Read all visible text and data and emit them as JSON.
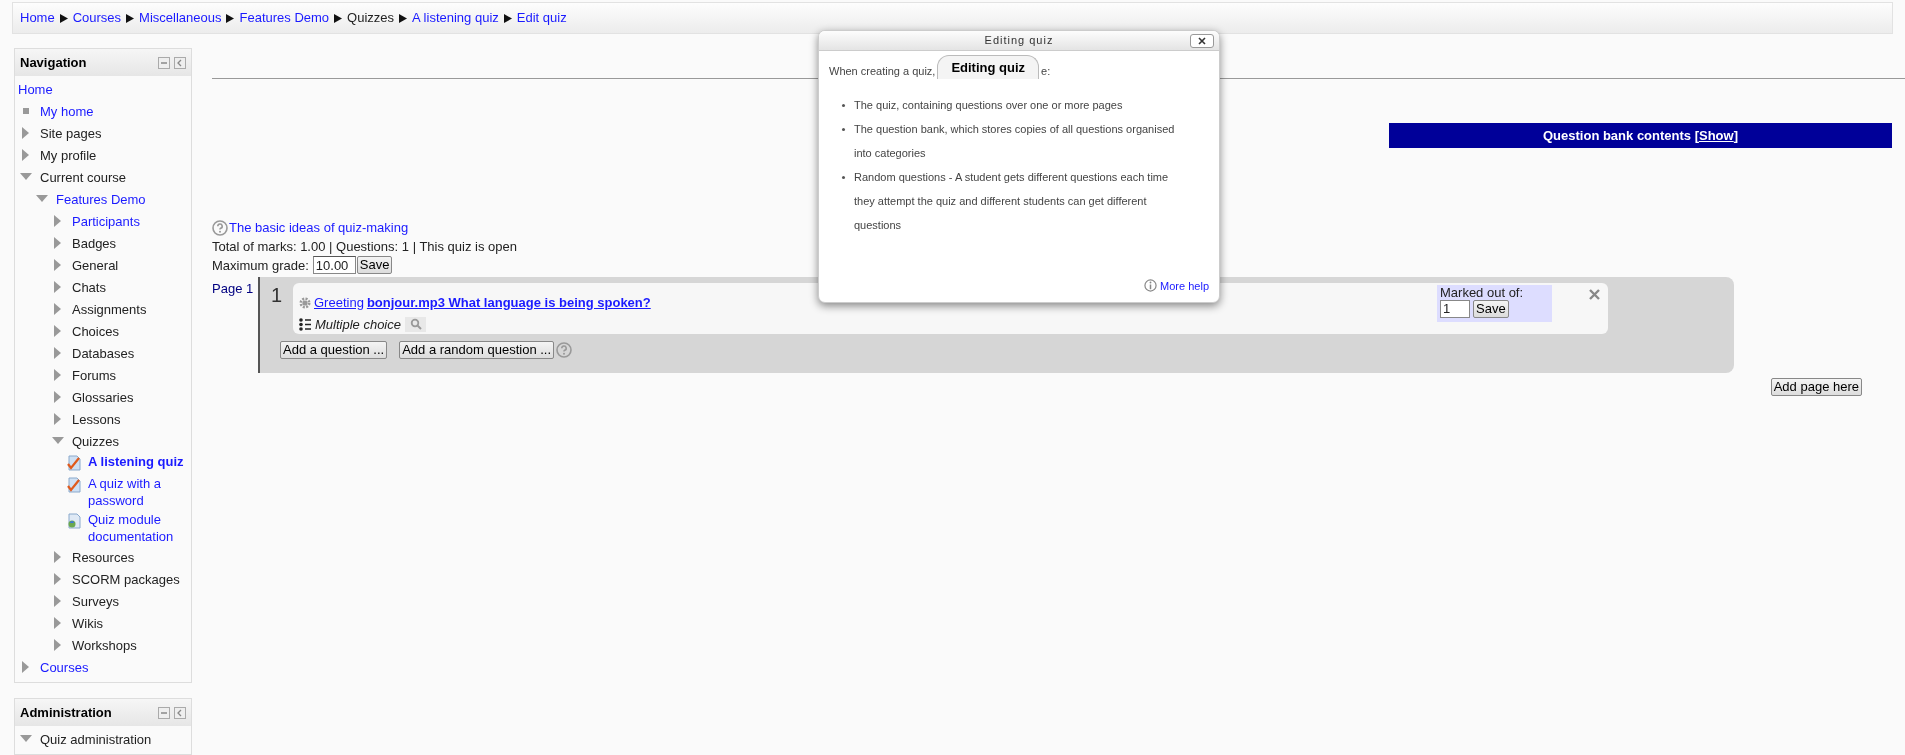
{
  "breadcrumb": [
    {
      "label": "Home",
      "link": true
    },
    {
      "label": "Courses",
      "link": true
    },
    {
      "label": "Miscellaneous",
      "link": true
    },
    {
      "label": "Features Demo",
      "link": true
    },
    {
      "label": "Quizzes",
      "link": false
    },
    {
      "label": "A listening quiz",
      "link": true
    },
    {
      "label": "Edit quiz",
      "link": true
    }
  ],
  "navigation": {
    "title": "Navigation",
    "items": [
      {
        "label": "Home",
        "link": true,
        "kind": "plain",
        "selected": false
      },
      {
        "label": "My home",
        "link": true,
        "kind": "square",
        "selected": false
      },
      {
        "label": "Site pages",
        "link": false,
        "kind": "triangle",
        "expanded": false,
        "selected": false
      },
      {
        "label": "My profile",
        "link": false,
        "kind": "triangle",
        "expanded": false,
        "selected": false
      },
      {
        "label": "Current course",
        "link": false,
        "kind": "triangle",
        "expanded": true,
        "selected": false,
        "children": [
          {
            "label": "Features Demo",
            "link": true,
            "kind": "triangle",
            "expanded": true,
            "selected": false,
            "children": [
              {
                "label": "Participants",
                "link": true,
                "kind": "triangle",
                "expanded": false,
                "selected": false
              },
              {
                "label": "Badges",
                "link": false,
                "kind": "triangle",
                "expanded": false,
                "selected": false
              },
              {
                "label": "General",
                "link": false,
                "kind": "triangle",
                "expanded": false,
                "selected": false
              },
              {
                "label": "Chats",
                "link": false,
                "kind": "triangle",
                "expanded": false,
                "selected": false
              },
              {
                "label": "Assignments",
                "link": false,
                "kind": "triangle",
                "expanded": false,
                "selected": false
              },
              {
                "label": "Choices",
                "link": false,
                "kind": "triangle",
                "expanded": false,
                "selected": false
              },
              {
                "label": "Databases",
                "link": false,
                "kind": "triangle",
                "expanded": false,
                "selected": false
              },
              {
                "label": "Forums",
                "link": false,
                "kind": "triangle",
                "expanded": false,
                "selected": false
              },
              {
                "label": "Glossaries",
                "link": false,
                "kind": "triangle",
                "expanded": false,
                "selected": false
              },
              {
                "label": "Lessons",
                "link": false,
                "kind": "triangle",
                "expanded": false,
                "selected": false
              },
              {
                "label": "Quizzes",
                "link": false,
                "kind": "triangle",
                "expanded": true,
                "selected": false,
                "children": [
                  {
                    "label": "A listening quiz",
                    "link": true,
                    "kind": "quiz",
                    "selected": true
                  },
                  {
                    "label": "A quiz with a password",
                    "link": true,
                    "kind": "quiz",
                    "selected": false
                  },
                  {
                    "label": "Quiz module documentation",
                    "link": true,
                    "kind": "page",
                    "selected": false
                  }
                ]
              },
              {
                "label": "Resources",
                "link": false,
                "kind": "triangle",
                "expanded": false,
                "selected": false
              },
              {
                "label": "SCORM packages",
                "link": false,
                "kind": "triangle",
                "expanded": false,
                "selected": false
              },
              {
                "label": "Surveys",
                "link": false,
                "kind": "triangle",
                "expanded": false,
                "selected": false
              },
              {
                "label": "Wikis",
                "link": false,
                "kind": "triangle",
                "expanded": false,
                "selected": false
              },
              {
                "label": "Workshops",
                "link": false,
                "kind": "triangle",
                "expanded": false,
                "selected": false
              }
            ]
          }
        ]
      },
      {
        "label": "Courses",
        "link": true,
        "kind": "triangle",
        "expanded": false,
        "selected": false
      }
    ]
  },
  "administration": {
    "title": "Administration",
    "items": [
      {
        "label": "Quiz administration",
        "link": false,
        "kind": "triangle",
        "expanded": true,
        "selected": false
      }
    ]
  },
  "question_bank": {
    "prefix": "Question bank contents [",
    "link": "Show",
    "suffix": "]"
  },
  "help_link": "The basic ideas of quiz-making",
  "summary": "Total of marks: 1.00 | Questions: 1 | This quiz is open",
  "max_grade": {
    "label": "Maximum grade:",
    "value": "10.00",
    "button": "Save"
  },
  "pages": [
    {
      "label": "Page 1",
      "questions": [
        {
          "number": "1",
          "category": "Greeting",
          "title": "bonjour.mp3 What language is being spoken?",
          "type": "Multiple choice",
          "marked_label": "Marked out of:",
          "mark": "1",
          "button": "Save"
        }
      ],
      "buttons": [
        "Add a question ...",
        "Add a random question ..."
      ]
    }
  ],
  "add_page_button": "Add page here",
  "help_dialog": {
    "title": "Editing quiz",
    "tooltip": "Editing quiz",
    "intro_start": "When creating a quiz,",
    "intro_end": "e:",
    "bullets": [
      "The quiz, containing questions over one or more pages",
      "The question bank, which stores copies of all questions organised into categories",
      "Random questions - A student gets different questions each time they attempt the quiz and different students can get different questions"
    ],
    "more_help": "More help"
  }
}
